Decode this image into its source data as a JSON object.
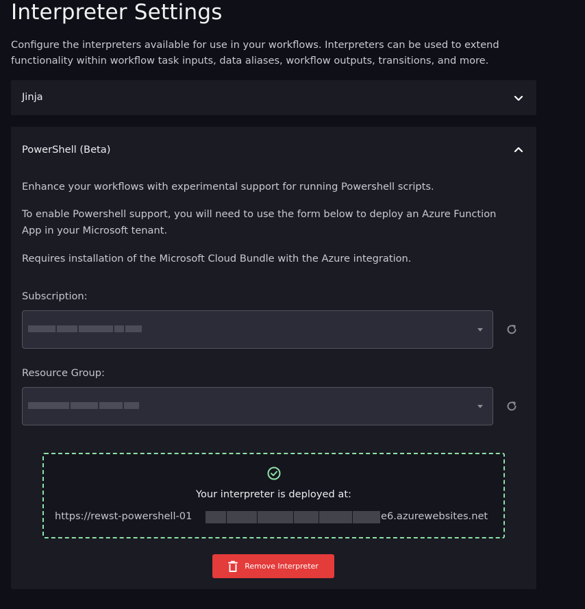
{
  "page": {
    "title": "Interpreter Settings",
    "description": "Configure the interpreters available for use in your workflows. Interpreters can be used to extend functionality within workflow task inputs, data aliases, workflow outputs, transitions, and more."
  },
  "interpreters": [
    {
      "label": "Jinja",
      "expanded": false,
      "toggle_icon": "chevron-down-icon"
    },
    {
      "label": "PowerShell (Beta)",
      "expanded": true,
      "toggle_icon": "chevron-up-icon",
      "paragraphs": [
        "Enhance your workflows with experimental support for running Powershell scripts.",
        "To enable Powershell support, you will need to use the form below to deploy an Azure Function App in your Microsoft tenant.",
        "Requires installation of the Microsoft Cloud Bundle with the Azure integration."
      ],
      "subscription": {
        "label": "Subscription:",
        "refresh_icon": "refresh-icon"
      },
      "resource_group": {
        "label": "Resource Group:",
        "refresh_icon": "refresh-icon"
      },
      "deployment": {
        "status_icon": "check-circle-icon",
        "status_color": "#8ee3a8",
        "title": "Your interpreter is deployed at:",
        "url_start": "https://rewst-powershell-01",
        "url_end": "e6.azurewebsites.net"
      },
      "remove_button": {
        "label": "Remove Interpreter",
        "icon": "trash-icon",
        "color": "#e43b3b"
      }
    }
  ]
}
